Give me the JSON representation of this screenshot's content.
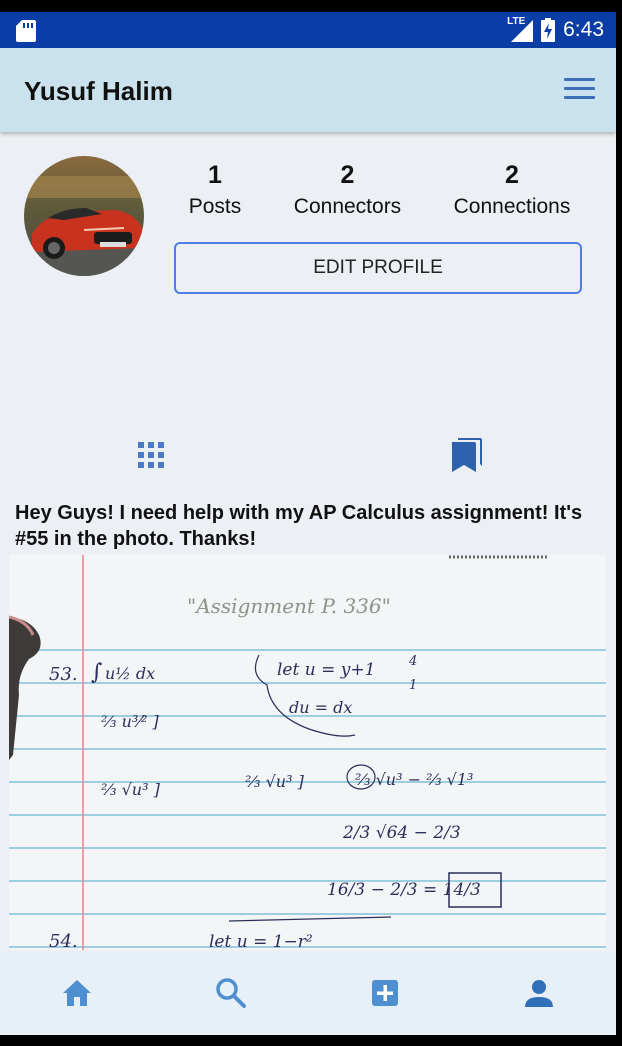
{
  "status_bar": {
    "network_label": "LTE",
    "time": "6:43"
  },
  "header": {
    "title": "Yusuf Halim",
    "menu_icon": "hamburger-menu-icon"
  },
  "profile": {
    "avatar_alt": "red convertible car",
    "stats": [
      {
        "value": "1",
        "label": "Posts"
      },
      {
        "value": "2",
        "label": "Connectors"
      },
      {
        "value": "2",
        "label": "Connections"
      }
    ],
    "edit_button_label": "EDIT PROFILE"
  },
  "tabs": {
    "grid_icon": "grid-icon",
    "saved_icon": "bookmark-icon"
  },
  "post": {
    "caption": "Hey Guys! I need help with my AP Calculus assignment! It's #55 in the photo. Thanks!",
    "photo": {
      "heading": "\"Assignment P. 336\"",
      "line_53": "53.",
      "line_54": "54.",
      "let_u": "let u = y+1",
      "du": "du = dx",
      "bounds_top": "4",
      "bounds_bottom": "1",
      "res1": "2/3 √64 − 2/3",
      "res2": "16/3 − 2/3 = 14/3",
      "let_u2": "let u = 1−r²"
    }
  },
  "bottom_nav": {
    "items": [
      {
        "name": "home",
        "icon": "home-icon"
      },
      {
        "name": "search",
        "icon": "search-icon"
      },
      {
        "name": "add-post",
        "icon": "add-box-icon"
      },
      {
        "name": "profile",
        "icon": "person-icon"
      }
    ]
  },
  "colors": {
    "status_bar": "#0a3ea6",
    "app_bar": "#c9e2ee",
    "accent": "#4d7fe6",
    "nav_icon": "#4e8fd0"
  }
}
